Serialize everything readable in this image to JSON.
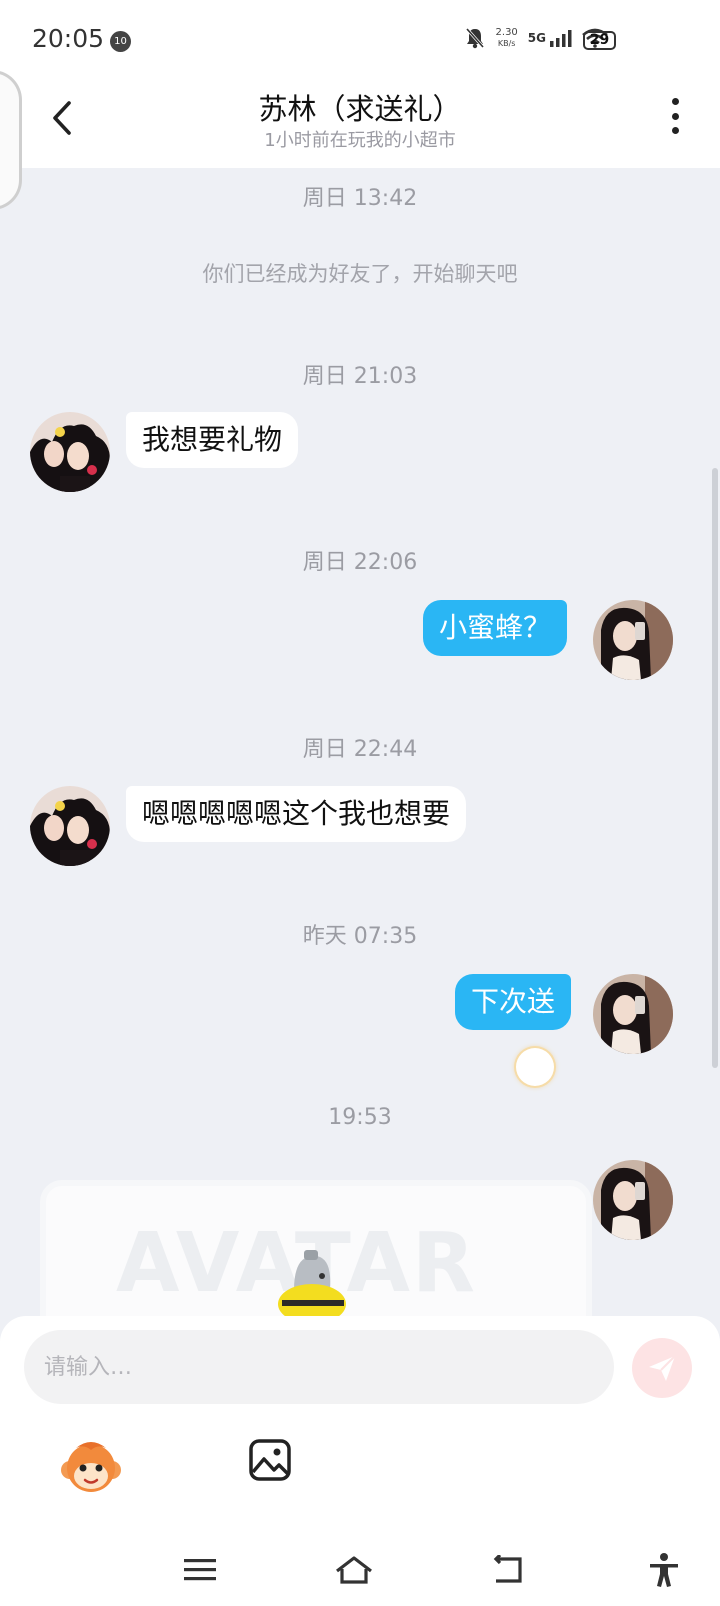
{
  "status_bar": {
    "time": "20:05",
    "notif_badge": "10",
    "net_speed_value": "2.30",
    "net_speed_unit": "KB/s",
    "signal_label": "5G",
    "battery": "29"
  },
  "header": {
    "title": "苏林（求送礼）",
    "subtitle": "1小时前在玩我的小超市"
  },
  "messages": {
    "ts1": "周日 13:42",
    "system": "你们已经成为好友了，开始聊天吧",
    "ts2": "周日 21:03",
    "m1": "我想要礼物",
    "ts3": "周日 22:06",
    "m2": "小蜜蜂？",
    "ts4": "周日 22:44",
    "m3": "嗯嗯嗯嗯嗯这个我也想要",
    "ts5": "昨天 07:35",
    "m4": "下次送",
    "ts6": "19:53"
  },
  "gift_card": {
    "watermark": "AVATAR"
  },
  "composer": {
    "placeholder": "请输入…",
    "value": ""
  },
  "colors": {
    "out_bubble": "#2ab6f4",
    "in_bubble": "#ffffff",
    "background": "#eef0f5",
    "send_button": "#fde3e4"
  },
  "icons": [
    "back-arrow-icon",
    "more-vertical-icon",
    "send-icon",
    "emoji-monkey-icon",
    "image-icon",
    "menu-icon",
    "home-icon",
    "back-icon",
    "accessibility-icon"
  ]
}
